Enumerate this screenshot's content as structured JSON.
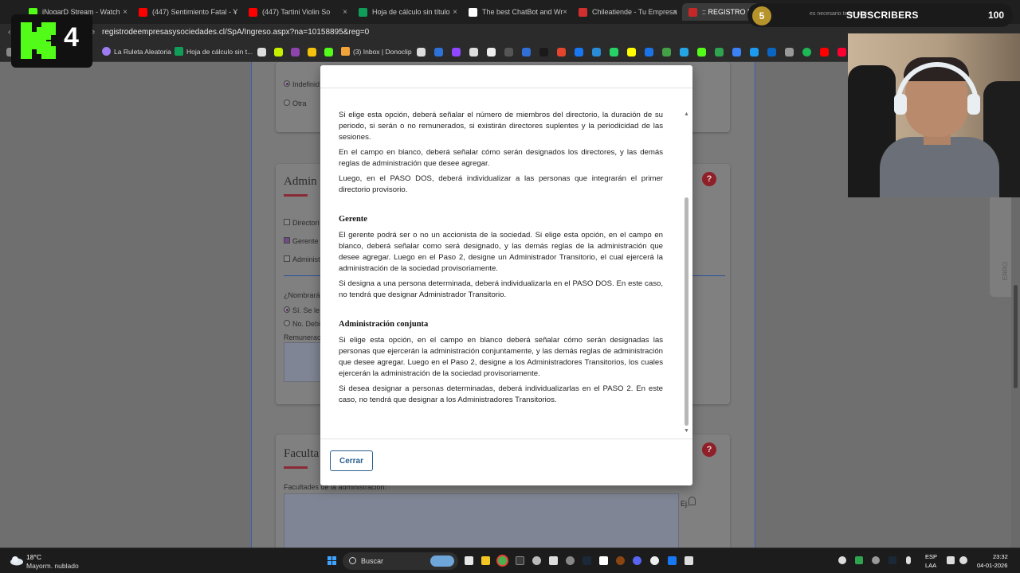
{
  "browser": {
    "tabs": [
      {
        "label": "iNogarD Stream - Watch",
        "color": "#53fc18"
      },
      {
        "label": "(447) Sentimiento Fatal - Y",
        "color": "#ff0000"
      },
      {
        "label": "(447) Tartini Violin So",
        "color": "#ff0000"
      },
      {
        "label": "Hoja de cálculo sin título",
        "color": "#0f9d58"
      },
      {
        "label": "The best ChatBot and Wr",
        "color": "#ffffff"
      },
      {
        "label": "Chileatiende - Tu Empresa",
        "color": "#d32f2f"
      },
      {
        "label": ":: REGISTRO DE E",
        "color": "#c62828"
      },
      {
        "label": "es necesario tener algún",
        "color": "#4285f4"
      }
    ],
    "url": "registrodeempresasysociedades.cl/SpA/Ingreso.aspx?na=10158895&reg=0",
    "bookmarks": [
      {
        "label": "La Ruleta Aleatoria",
        "color": "#9c7cf0"
      },
      {
        "label": "Hoja de cálculo sin t...",
        "color": "#0f9d58"
      },
      {
        "label": "(3) Inbox | Donoclip",
        "color": "#f2a33a"
      }
    ]
  },
  "page": {
    "radio_indefinido": "Indefinid",
    "radio_otra": "Otra",
    "admin_title": "Admin",
    "check_directorio": "Directori",
    "check_gerente": "Gerente",
    "check_administracion": "Administ",
    "nombrara_label": "¿Nombrará",
    "radio_si": "Sí. Se le",
    "radio_no": "No. Debi",
    "remuneracion_label": "Remunerac",
    "facultades_title": "Faculta",
    "facultades_label": "Facultades de la administración:",
    "ej_label": "Ej.",
    "side_tab": "ERRO",
    "help_symbol": "?"
  },
  "modal": {
    "paragraphs_intro": [
      "Si elige esta opción, deberá señalar el número de miembros del directorio, la duración de su periodo, si serán o no remunerados, si existirán directores suplentes y la periodicidad de las sesiones.",
      "En el campo en blanco, deberá señalar cómo serán designados los directores, y las demás reglas de administración que desee agregar.",
      "Luego, en el PASO DOS, deberá individualizar a las personas que integrarán el primer directorio provisorio."
    ],
    "gerente_heading": "Gerente",
    "gerente_paragraphs": [
      "El gerente podrá ser o no un accionista de la sociedad. Si elige esta opción, en el campo en blanco, deberá señalar como será designado, y las demás reglas de la administración que desee agregar. Luego en el Paso 2, designe un Administrador Transitorio, el cual ejercerá la administración de la sociedad provisoriamente.",
      "Si designa a una persona determinada, deberá individualizarla en el PASO DOS. En este caso, no tendrá que designar Administrador Transitorio."
    ],
    "conjunta_heading": "Administración conjunta",
    "conjunta_paragraphs": [
      "Si elige esta opción, en el campo en blanco deberá señalar cómo serán designadas las personas que ejercerán la administración conjuntamente, y las demás reglas de administración que desee agregar. Luego en el Paso 2, designe a los Administradores Transitorios, los cuales ejercerán la administración de la sociedad provisoriamente.",
      "Si desea designar a personas determinadas, deberá individualizarlas en el PASO 2. En este caso, no tendrá que designar a los Administradores Transitorios."
    ],
    "close_label": "Cerrar"
  },
  "overlay": {
    "k4_number": "4",
    "subs_initial": "5",
    "subs_label": "SUBSCRIBERS",
    "subs_count": "100",
    "subs_faint": "es necesario tener algún"
  },
  "taskbar": {
    "temp": "18°C",
    "weather": "Mayorm. nublado",
    "search": "Buscar",
    "lang_top": "ESP",
    "lang_bottom": "LAA",
    "time": "23:32",
    "date": "04-01-2026"
  }
}
